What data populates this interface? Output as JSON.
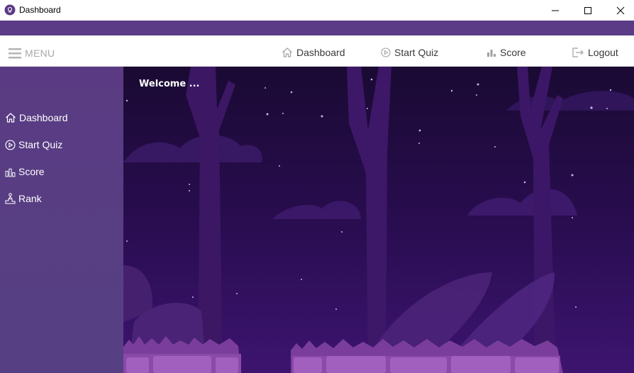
{
  "window": {
    "title": "Dashboard",
    "minimize_icon": "minimize-icon",
    "maximize_icon": "maximize-icon",
    "close_icon": "close-icon"
  },
  "topnav": {
    "menu_label": "MENU",
    "items": [
      {
        "label": "Dashboard",
        "icon": "home-icon"
      },
      {
        "label": "Start Quiz",
        "icon": "play-circle-icon"
      },
      {
        "label": "Score",
        "icon": "bar-chart-icon"
      },
      {
        "label": "Logout",
        "icon": "logout-icon"
      }
    ]
  },
  "sidebar": {
    "items": [
      {
        "label": "Dashboard",
        "icon": "home-icon"
      },
      {
        "label": "Start Quiz",
        "icon": "play-circle-icon"
      },
      {
        "label": "Score",
        "icon": "bar-chart-icon"
      },
      {
        "label": "Rank",
        "icon": "podium-person-icon"
      }
    ]
  },
  "main": {
    "welcome": "Welcome ..."
  },
  "colors": {
    "accent_strip": "#5b3a86",
    "sidebar": "#5a3b83",
    "night_sky": "#1e0a3c",
    "topnav_text": "#3a3a3a"
  }
}
